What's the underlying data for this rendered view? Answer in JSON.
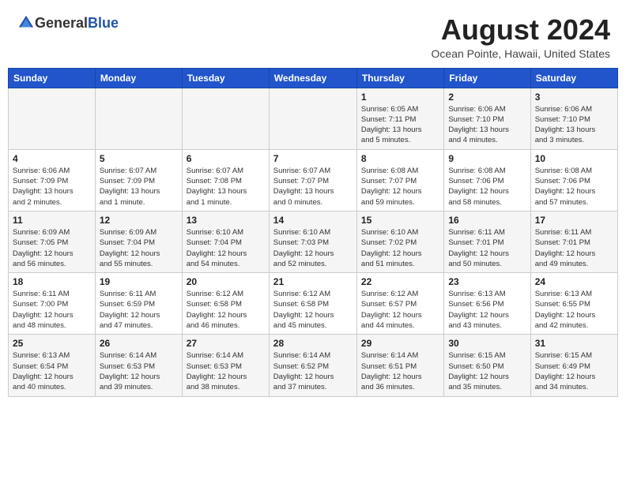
{
  "header": {
    "logo_general": "General",
    "logo_blue": "Blue",
    "month_title": "August 2024",
    "location": "Ocean Pointe, Hawaii, United States"
  },
  "weekdays": [
    "Sunday",
    "Monday",
    "Tuesday",
    "Wednesday",
    "Thursday",
    "Friday",
    "Saturday"
  ],
  "weeks": [
    [
      {
        "day": "",
        "info": ""
      },
      {
        "day": "",
        "info": ""
      },
      {
        "day": "",
        "info": ""
      },
      {
        "day": "",
        "info": ""
      },
      {
        "day": "1",
        "info": "Sunrise: 6:05 AM\nSunset: 7:11 PM\nDaylight: 13 hours\nand 5 minutes."
      },
      {
        "day": "2",
        "info": "Sunrise: 6:06 AM\nSunset: 7:10 PM\nDaylight: 13 hours\nand 4 minutes."
      },
      {
        "day": "3",
        "info": "Sunrise: 6:06 AM\nSunset: 7:10 PM\nDaylight: 13 hours\nand 3 minutes."
      }
    ],
    [
      {
        "day": "4",
        "info": "Sunrise: 6:06 AM\nSunset: 7:09 PM\nDaylight: 13 hours\nand 2 minutes."
      },
      {
        "day": "5",
        "info": "Sunrise: 6:07 AM\nSunset: 7:09 PM\nDaylight: 13 hours\nand 1 minute."
      },
      {
        "day": "6",
        "info": "Sunrise: 6:07 AM\nSunset: 7:08 PM\nDaylight: 13 hours\nand 1 minute."
      },
      {
        "day": "7",
        "info": "Sunrise: 6:07 AM\nSunset: 7:07 PM\nDaylight: 13 hours\nand 0 minutes."
      },
      {
        "day": "8",
        "info": "Sunrise: 6:08 AM\nSunset: 7:07 PM\nDaylight: 12 hours\nand 59 minutes."
      },
      {
        "day": "9",
        "info": "Sunrise: 6:08 AM\nSunset: 7:06 PM\nDaylight: 12 hours\nand 58 minutes."
      },
      {
        "day": "10",
        "info": "Sunrise: 6:08 AM\nSunset: 7:06 PM\nDaylight: 12 hours\nand 57 minutes."
      }
    ],
    [
      {
        "day": "11",
        "info": "Sunrise: 6:09 AM\nSunset: 7:05 PM\nDaylight: 12 hours\nand 56 minutes."
      },
      {
        "day": "12",
        "info": "Sunrise: 6:09 AM\nSunset: 7:04 PM\nDaylight: 12 hours\nand 55 minutes."
      },
      {
        "day": "13",
        "info": "Sunrise: 6:10 AM\nSunset: 7:04 PM\nDaylight: 12 hours\nand 54 minutes."
      },
      {
        "day": "14",
        "info": "Sunrise: 6:10 AM\nSunset: 7:03 PM\nDaylight: 12 hours\nand 52 minutes."
      },
      {
        "day": "15",
        "info": "Sunrise: 6:10 AM\nSunset: 7:02 PM\nDaylight: 12 hours\nand 51 minutes."
      },
      {
        "day": "16",
        "info": "Sunrise: 6:11 AM\nSunset: 7:01 PM\nDaylight: 12 hours\nand 50 minutes."
      },
      {
        "day": "17",
        "info": "Sunrise: 6:11 AM\nSunset: 7:01 PM\nDaylight: 12 hours\nand 49 minutes."
      }
    ],
    [
      {
        "day": "18",
        "info": "Sunrise: 6:11 AM\nSunset: 7:00 PM\nDaylight: 12 hours\nand 48 minutes."
      },
      {
        "day": "19",
        "info": "Sunrise: 6:11 AM\nSunset: 6:59 PM\nDaylight: 12 hours\nand 47 minutes."
      },
      {
        "day": "20",
        "info": "Sunrise: 6:12 AM\nSunset: 6:58 PM\nDaylight: 12 hours\nand 46 minutes."
      },
      {
        "day": "21",
        "info": "Sunrise: 6:12 AM\nSunset: 6:58 PM\nDaylight: 12 hours\nand 45 minutes."
      },
      {
        "day": "22",
        "info": "Sunrise: 6:12 AM\nSunset: 6:57 PM\nDaylight: 12 hours\nand 44 minutes."
      },
      {
        "day": "23",
        "info": "Sunrise: 6:13 AM\nSunset: 6:56 PM\nDaylight: 12 hours\nand 43 minutes."
      },
      {
        "day": "24",
        "info": "Sunrise: 6:13 AM\nSunset: 6:55 PM\nDaylight: 12 hours\nand 42 minutes."
      }
    ],
    [
      {
        "day": "25",
        "info": "Sunrise: 6:13 AM\nSunset: 6:54 PM\nDaylight: 12 hours\nand 40 minutes."
      },
      {
        "day": "26",
        "info": "Sunrise: 6:14 AM\nSunset: 6:53 PM\nDaylight: 12 hours\nand 39 minutes."
      },
      {
        "day": "27",
        "info": "Sunrise: 6:14 AM\nSunset: 6:53 PM\nDaylight: 12 hours\nand 38 minutes."
      },
      {
        "day": "28",
        "info": "Sunrise: 6:14 AM\nSunset: 6:52 PM\nDaylight: 12 hours\nand 37 minutes."
      },
      {
        "day": "29",
        "info": "Sunrise: 6:14 AM\nSunset: 6:51 PM\nDaylight: 12 hours\nand 36 minutes."
      },
      {
        "day": "30",
        "info": "Sunrise: 6:15 AM\nSunset: 6:50 PM\nDaylight: 12 hours\nand 35 minutes."
      },
      {
        "day": "31",
        "info": "Sunrise: 6:15 AM\nSunset: 6:49 PM\nDaylight: 12 hours\nand 34 minutes."
      }
    ]
  ]
}
